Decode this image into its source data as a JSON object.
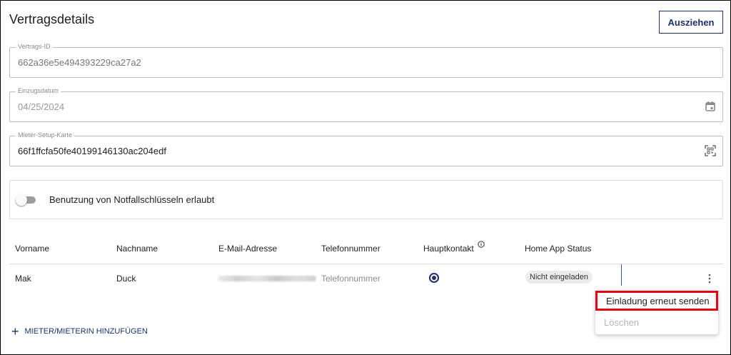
{
  "header": {
    "title": "Vertragsdetails",
    "action_button": "Ausziehen"
  },
  "fields": {
    "contract_id": {
      "label": "Vertrags-ID",
      "value": "662a36e5e494393229ca27a2"
    },
    "move_in_date": {
      "label": "Einzugsdatum",
      "value": "04/25/2024",
      "icon": "calendar-icon"
    },
    "setup_card": {
      "label": "Mieter-Setup-Karte",
      "value": "66f1ffcfa50fe40199146130ac204edf",
      "icon": "qr-scan-icon"
    }
  },
  "emergency_keys": {
    "label": "Benutzung von Notfallschlüsseln erlaubt",
    "enabled": false
  },
  "table": {
    "headers": [
      "Vorname",
      "Nachname",
      "E-Mail-Adresse",
      "Telefonnummer",
      "Hauptkontakt",
      "Home App Status"
    ],
    "rows": [
      {
        "first_name": "Mak",
        "last_name": "Duck",
        "phone": "Telefonnummer",
        "main_contact": true,
        "status": "Nicht eingeladen"
      }
    ]
  },
  "row_menu": {
    "items": [
      "Einladung erneut senden",
      "Löschen"
    ]
  },
  "add_tenant_label": "MIETER/MIETERIN HINZUFÜGEN",
  "colors": {
    "primary": "#1f2f6b",
    "highlight_border": "#e30613"
  }
}
